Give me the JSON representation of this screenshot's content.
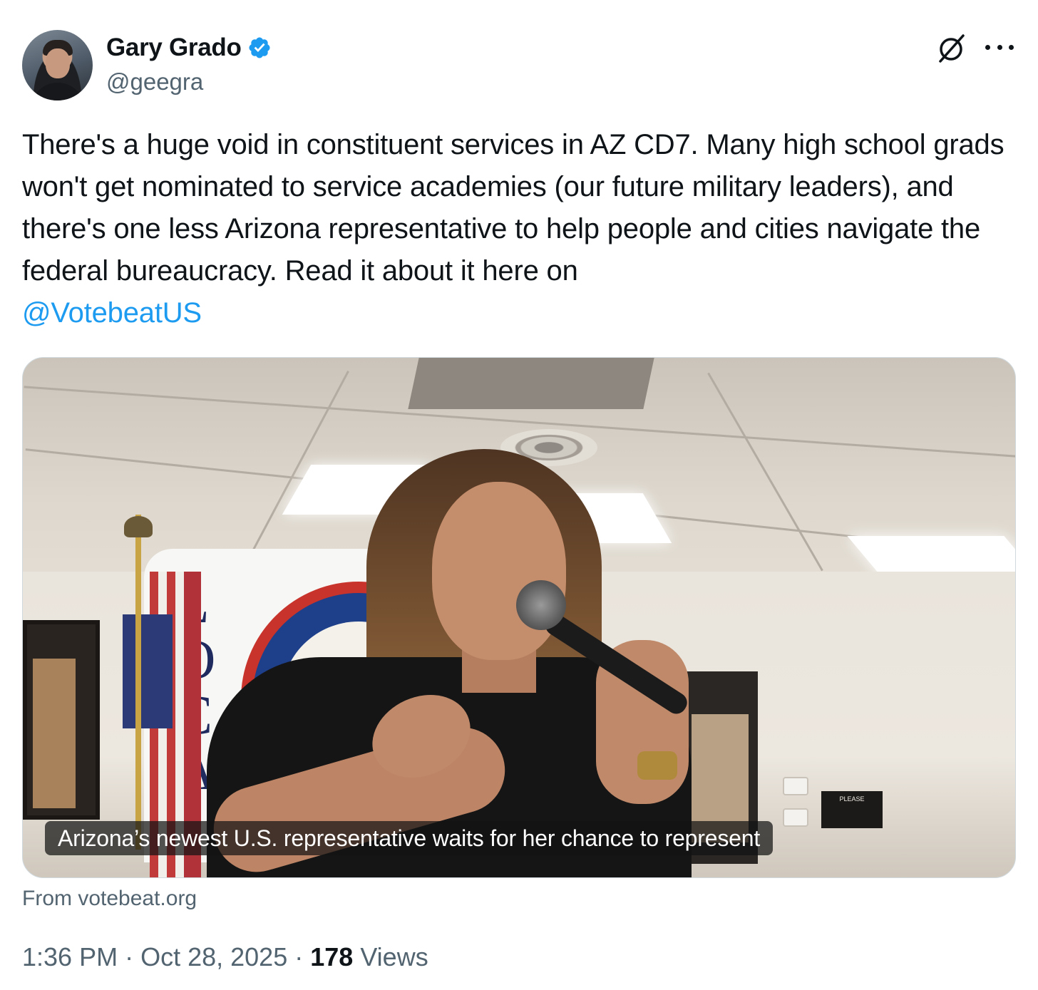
{
  "author": {
    "display_name": "Gary Grado",
    "handle": "@geegra",
    "verified": true,
    "verified_color": "#1d9bf0"
  },
  "icons": {
    "avatar": "author-avatar",
    "verified": "verified-badge-icon",
    "grok": "grok-icon",
    "more": "more-options-icon"
  },
  "tweet": {
    "text": "There's a huge void in constituent services in AZ CD7. Many high school grads won't get nominated to service academies (our future military leaders), and there's one less Arizona representative to help people and cities navigate the federal bureaucracy. Read it about it here on",
    "mention": "@VotebeatUS",
    "mention_color": "#1d9bf0"
  },
  "card": {
    "caption": "Arizona’s newest U.S. representative waits for her chance to represent",
    "source": "From votebeat.org",
    "photo_letters": [
      "L",
      "O",
      "C",
      "A"
    ],
    "sign_text": "PLEASE"
  },
  "meta": {
    "time": "1:36 PM",
    "separator": "·",
    "date": "Oct 28, 2025",
    "views_count": "178",
    "views_label": "Views"
  }
}
